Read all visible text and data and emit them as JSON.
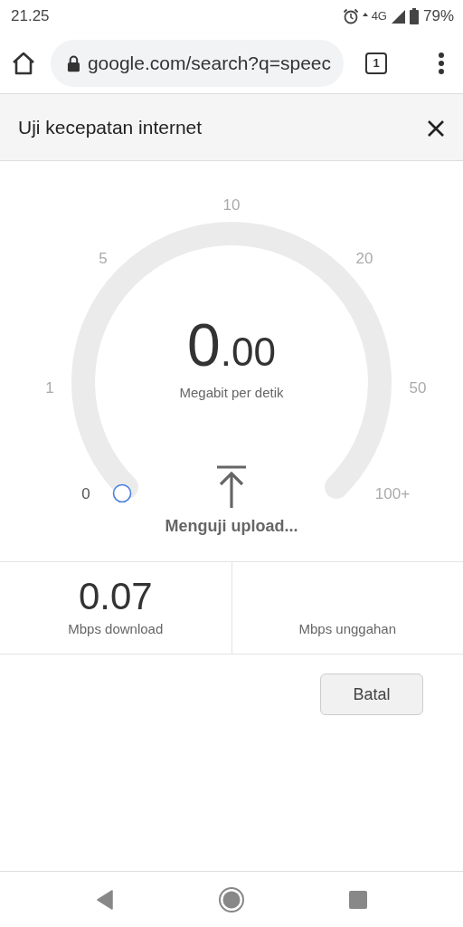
{
  "status_bar": {
    "time": "21.25",
    "network": "4G",
    "battery": "79%"
  },
  "browser": {
    "url": "google.com/search?q=speec",
    "tab_count": "1"
  },
  "panel": {
    "title": "Uji kecepatan internet"
  },
  "gauge": {
    "ticks": [
      "0",
      "1",
      "5",
      "10",
      "20",
      "50",
      "100+"
    ],
    "reading": "0.00",
    "unit": "Megabit per detik",
    "status": "Menguji upload..."
  },
  "results": [
    {
      "value": "0.07",
      "label": "Mbps download"
    },
    {
      "label": "Mbps unggahan"
    }
  ],
  "buttons": [
    "Batal"
  ]
}
